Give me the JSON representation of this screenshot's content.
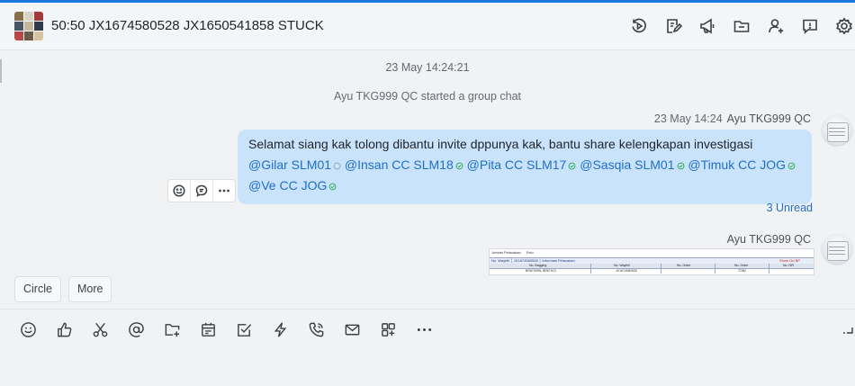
{
  "colors": {
    "accent": "#1f7ae0",
    "bubble": "#c9e3fc",
    "mention": "#1f6fc8",
    "read_check": "#2fa84f",
    "unread_circle": "#9aa0a6"
  },
  "chat": {
    "title": "50:50 JX1674580528 JX1650541858 STUCK"
  },
  "header_actions": [
    {
      "icon": "replay-icon"
    },
    {
      "icon": "edit-doc-icon"
    },
    {
      "icon": "announcement-icon"
    },
    {
      "icon": "folder-icon"
    },
    {
      "icon": "add-member-icon"
    },
    {
      "icon": "message-alert-icon"
    },
    {
      "icon": "settings-icon"
    }
  ],
  "feed": {
    "timestamp": "23 May 14:24:21",
    "system_message": "Ayu TKG999 QC started a group chat",
    "message1": {
      "time": "23 May 14:24",
      "sender": "Ayu TKG999 QC",
      "text": "Selamat siang kak tolong dibantu invite dppunya kak, bantu share kelengkapan investigasi",
      "mentions": [
        {
          "name": "@Gilar SLM01",
          "read": false
        },
        {
          "name": "@Insan CC SLM18",
          "read": true
        },
        {
          "name": "@Pita CC SLM17",
          "read": true
        },
        {
          "name": "@Sasqia SLM01",
          "read": true
        },
        {
          "name": "@Timuk CC JOG",
          "read": true
        },
        {
          "name": "@Ve CC JOG",
          "read": true
        }
      ],
      "unread": "3 Unread"
    },
    "message2": {
      "sender": "Ayu TKG999 QC",
      "image": {
        "tabs": [
          "Jumlah Pelacakan",
          "Foto"
        ],
        "header_left": "No. Waybill │ JX1674580528 │ Informasi Pelacakan",
        "header_right": "Show On BP",
        "columns": [
          "No. Bagging",
          "No. Waybill",
          "No. Order",
          "No. Order",
          "No. NPI"
        ],
        "row": [
          "BR67909N, BR67010",
          "JX1674580528",
          "",
          "TOB2",
          ""
        ]
      }
    }
  },
  "quick_actions": [
    "Circle",
    "More"
  ],
  "message_tools": [
    {
      "icon": "emoji-reaction-icon"
    },
    {
      "icon": "reply-icon"
    },
    {
      "icon": "more-icon"
    }
  ],
  "composer_tools": [
    {
      "icon": "emoji-icon"
    },
    {
      "icon": "thumbs-up-icon"
    },
    {
      "icon": "scissors-icon"
    },
    {
      "icon": "mention-icon"
    },
    {
      "icon": "add-folder-icon"
    },
    {
      "icon": "calendar-icon"
    },
    {
      "icon": "task-icon"
    },
    {
      "icon": "lightning-icon"
    },
    {
      "icon": "call-icon"
    },
    {
      "icon": "mail-icon"
    },
    {
      "icon": "apps-icon"
    },
    {
      "icon": "more-icon"
    }
  ]
}
